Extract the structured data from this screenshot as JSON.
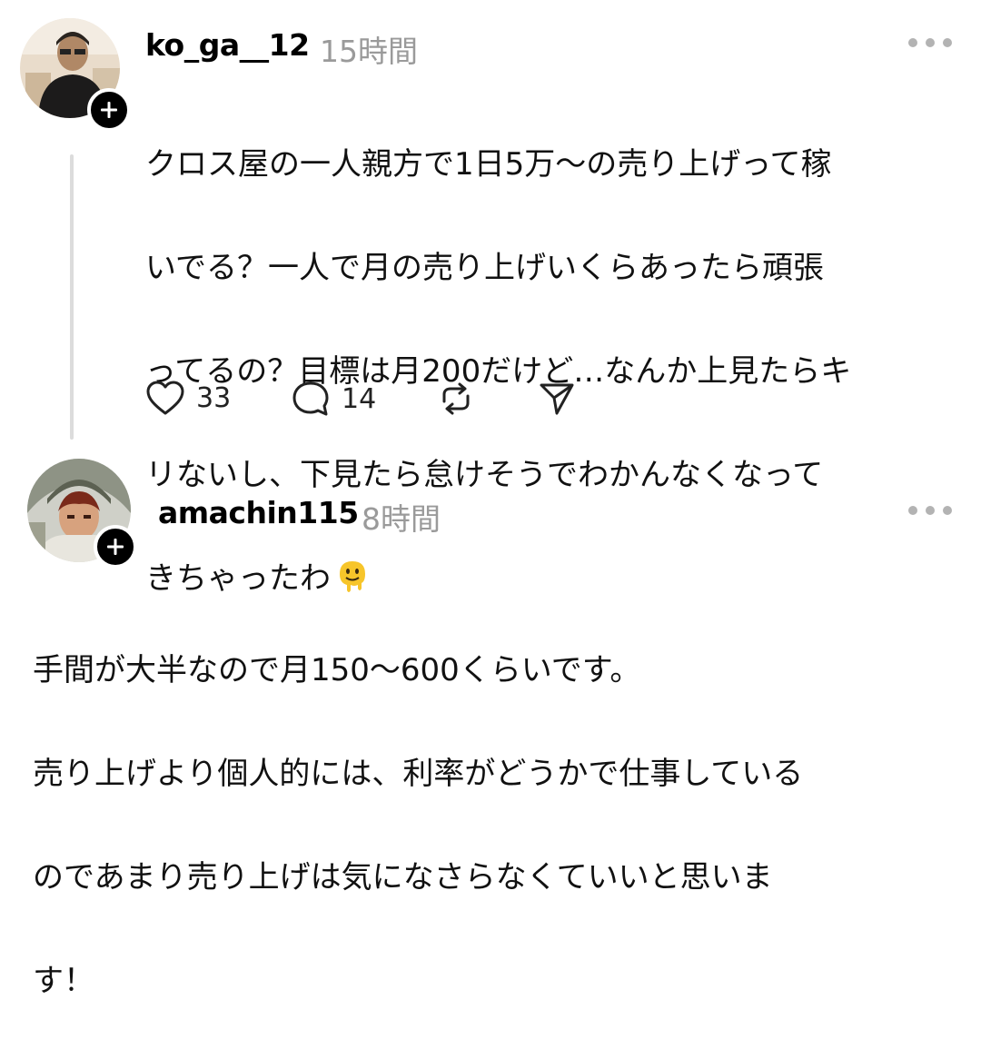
{
  "post": {
    "username": "ko_ga__12",
    "timestamp": "15時間",
    "lines": [
      "クロス屋の一人親方で1日5万〜の売り上げって稼",
      "いでる？一人で月の売り上げいくらあったら頑張",
      "ってるの？目標は月200だけど…なんか上見たらキ",
      "リないし、下見たら怠けそうでわかんなくなって",
      "きちゃったわ"
    ],
    "emoji": "melting-face",
    "actions": {
      "likes": "33",
      "replies": "14"
    }
  },
  "reply": {
    "username": "amachin115",
    "timestamp": "8時間",
    "lines": [
      "手間が大半なので月150〜600くらいです。",
      "売り上げより個人的には、利率がどうかで仕事している",
      "のであまり売り上げは気になさらなくていいと思いま",
      "す！"
    ]
  },
  "colors": {
    "text": "#111111",
    "muted": "#9a9a9a",
    "thread_line": "#dcdcdc",
    "emoji": "#f7c52a"
  }
}
